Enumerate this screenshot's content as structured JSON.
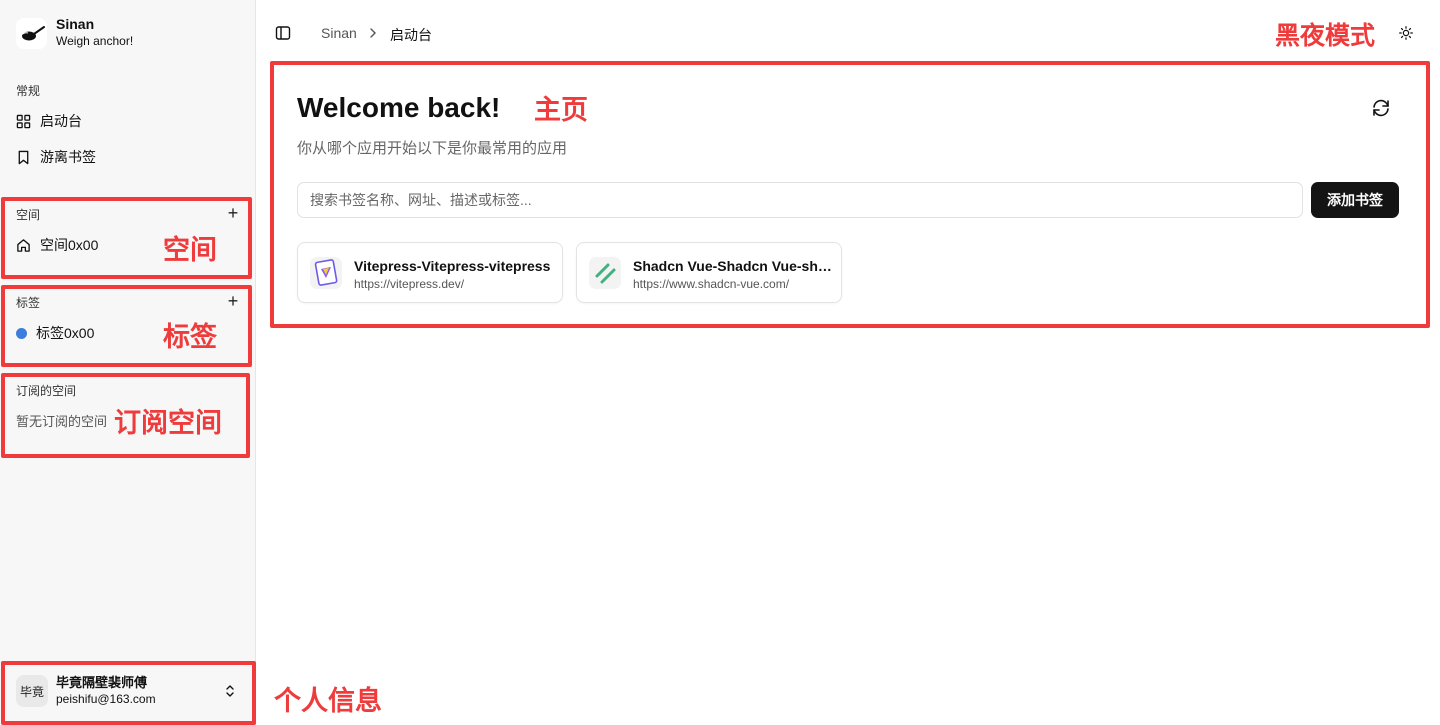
{
  "sidebar": {
    "brand": {
      "name": "Sinan",
      "subtitle": "Weigh anchor!"
    },
    "general": {
      "label": "常规",
      "items": [
        {
          "label": "启动台",
          "icon": "grid-icon"
        },
        {
          "label": "游离书签",
          "icon": "bookmark-icon"
        }
      ]
    },
    "spaces": {
      "label": "空间",
      "add": "+",
      "items": [
        {
          "label": "空间0x00",
          "icon": "home-icon"
        }
      ]
    },
    "tags": {
      "label": "标签",
      "add": "+",
      "items": [
        {
          "label": "标签0x00",
          "color": "#3b7ddd"
        }
      ]
    },
    "subscribed": {
      "label": "订阅的空间",
      "empty": "暂无订阅的空间"
    },
    "user": {
      "avatar": "毕竟",
      "name": "毕竟隔壁裴师傅",
      "email": "peishifu@163.com"
    }
  },
  "header": {
    "breadcrumb": [
      "Sinan",
      "启动台"
    ]
  },
  "main": {
    "title": "Welcome back!",
    "subtitle": "你从哪个应用开始以下是你最常用的应用",
    "search_placeholder": "搜索书签名称、网址、描述或标签...",
    "add_button": "添加书签",
    "cards": [
      {
        "title": "Vitepress-Vitepress-vitepress",
        "url": "https://vitepress.dev/",
        "icon": "vitepress-icon"
      },
      {
        "title": "Shadcn Vue-Shadcn Vue-shadcn",
        "url": "https://www.shadcn-vue.com/",
        "icon": "shadcn-icon"
      }
    ]
  },
  "annotations": {
    "dark_mode": "黑夜模式",
    "home": "主页",
    "space": "空间",
    "tag": "标签",
    "subscribed": "订阅空间",
    "profile": "个人信息"
  },
  "colors": {
    "annotation": "#ef3b3b",
    "accent_dark": "#141414",
    "tag_dot": "#3b7ddd"
  }
}
